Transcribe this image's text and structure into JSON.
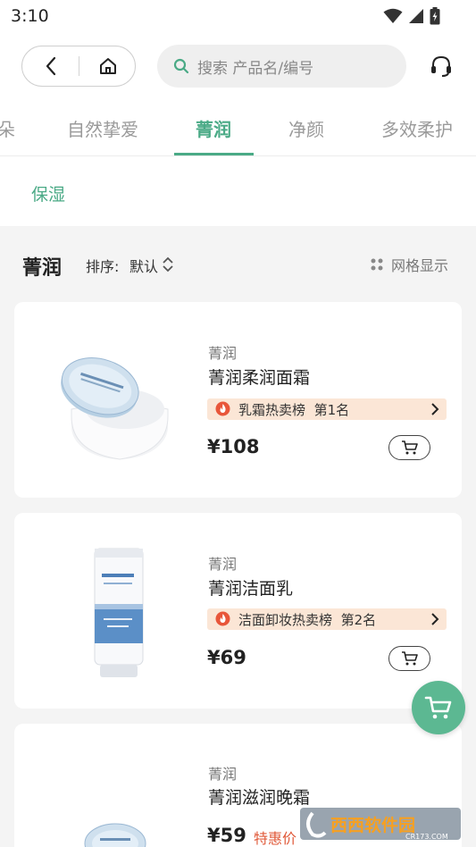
{
  "status": {
    "time": "3:10"
  },
  "search": {
    "placeholder": "搜索 产品名/编号"
  },
  "categories": {
    "tabs": [
      {
        "label": "朵"
      },
      {
        "label": "自然挚爱"
      },
      {
        "label": "菁润"
      },
      {
        "label": "净颜"
      },
      {
        "label": "多效柔护"
      }
    ],
    "active_index": 2
  },
  "subcategory": {
    "label": "保湿"
  },
  "list": {
    "title": "菁润",
    "sort_label": "排序:",
    "sort_value": "默认",
    "view_label": "网格显示"
  },
  "products": [
    {
      "brand": "菁润",
      "name": "菁润柔润面霜",
      "rank_text": "乳霜热卖榜",
      "rank_pos": "第1名",
      "price": "¥108",
      "tag": ""
    },
    {
      "brand": "菁润",
      "name": "菁润洁面乳",
      "rank_text": "洁面卸妆热卖榜",
      "rank_pos": "第2名",
      "price": "¥69",
      "tag": ""
    },
    {
      "brand": "菁润",
      "name": "菁润滋润晚霜",
      "rank_text": "",
      "rank_pos": "",
      "price": "¥59",
      "tag": "特惠价"
    }
  ],
  "watermark": {
    "text": "西西软件园",
    "sub": "CR173.COM"
  },
  "colors": {
    "accent": "#4aaa86",
    "float_cart": "#5cb892",
    "rank_bg": "#fbe6d6",
    "special": "#e05a3a"
  }
}
